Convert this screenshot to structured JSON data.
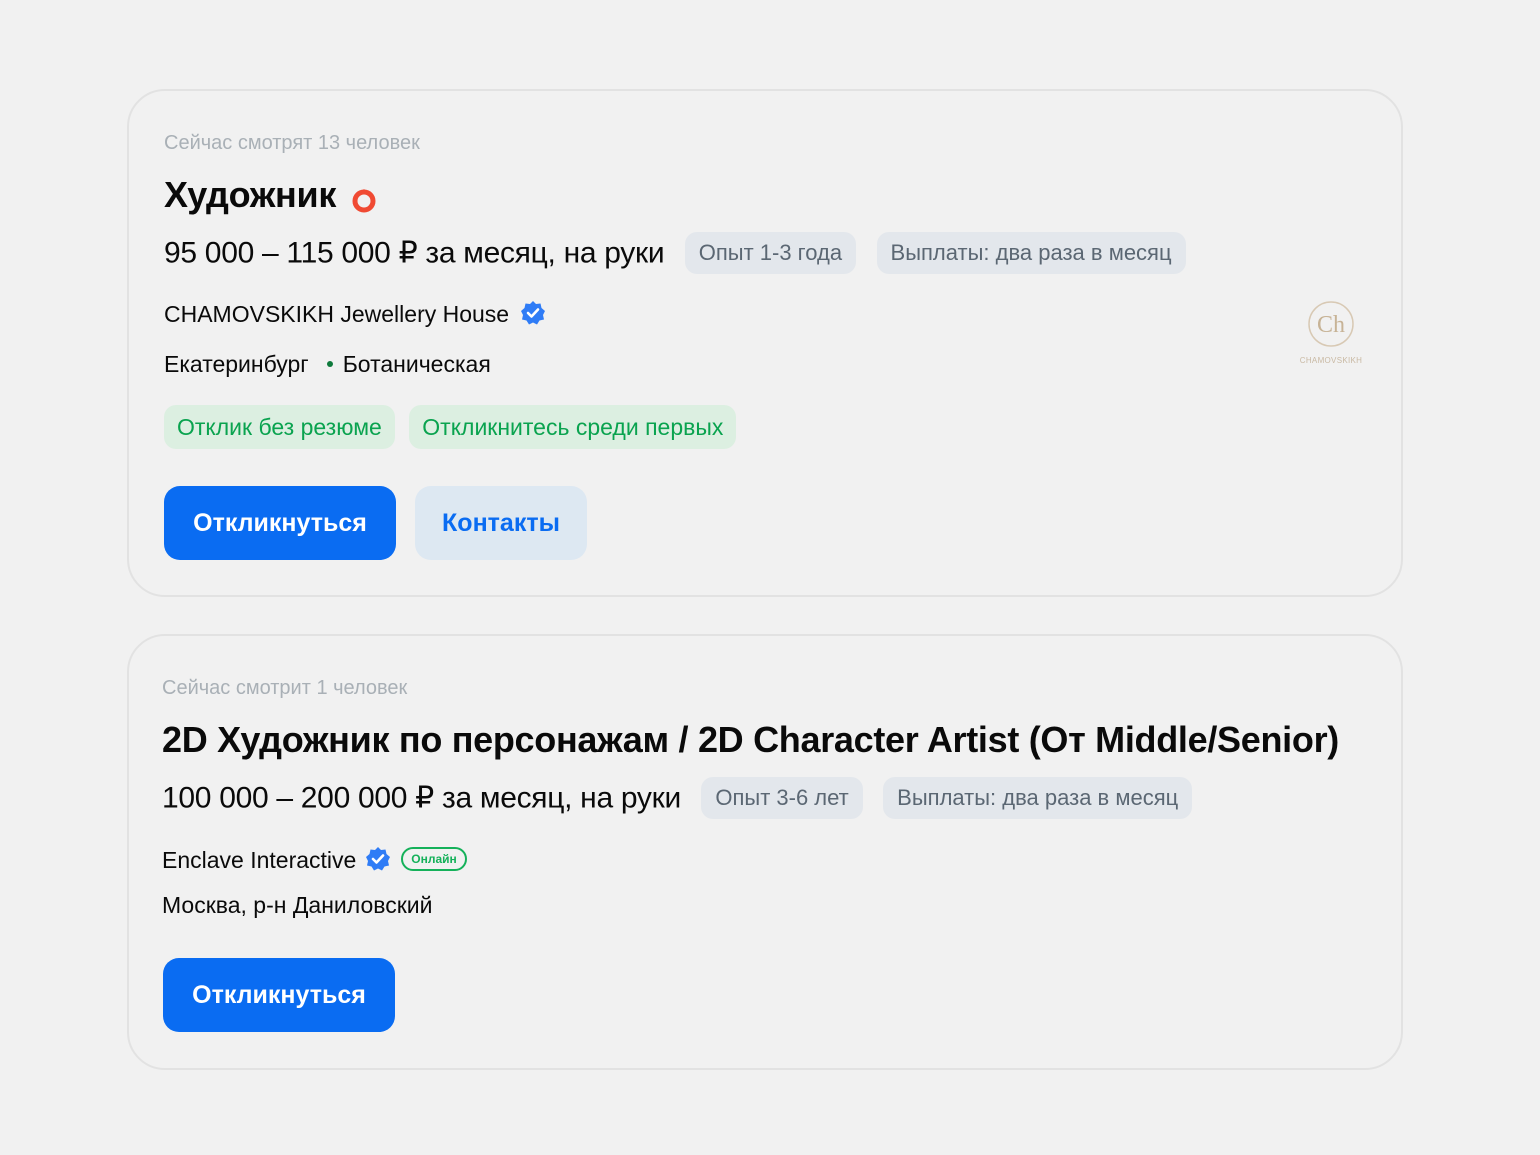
{
  "vacancies": [
    {
      "viewers": "Сейчас смотрят 13 человек",
      "title": "Художник",
      "salary": "95 000 – 115 000 ₽ за месяц, на руки",
      "experience": "Опыт 1-3 года",
      "payouts": "Выплаты: два раза в месяц",
      "company": "CHAMOVSKIKH Jewellery House",
      "city": "Екатеринбург",
      "metro": "Ботаническая",
      "tags": [
        "Отклик без резюме",
        "Откликнитесь среди первых"
      ],
      "apply_label": "Откликнуться",
      "contacts_label": "Контакты",
      "logo_text": "CHAMOVSKIKH"
    },
    {
      "viewers": "Сейчас смотрит 1 человек",
      "title": "2D Художник по персонажам / 2D Character Artist (От Middle/Senior)",
      "salary": "100 000 – 200 000 ₽ за месяц, на руки",
      "experience": "Опыт 3-6 лет",
      "payouts": "Выплаты: два раза в месяц",
      "company": "Enclave Interactive",
      "online_badge": "Онлайн",
      "location": "Москва, р-н Даниловский",
      "apply_label": "Откликнуться"
    }
  ],
  "colors": {
    "primary": "#0a6cf2",
    "hot": "#f04a33",
    "verified": "#2f7cf6",
    "green_text": "#0aa34f",
    "green_bg": "#dcefe1",
    "chip_bg": "#e3e7ec"
  },
  "icons": {
    "hot": "fire-icon",
    "verified": "verified-badge-icon"
  }
}
